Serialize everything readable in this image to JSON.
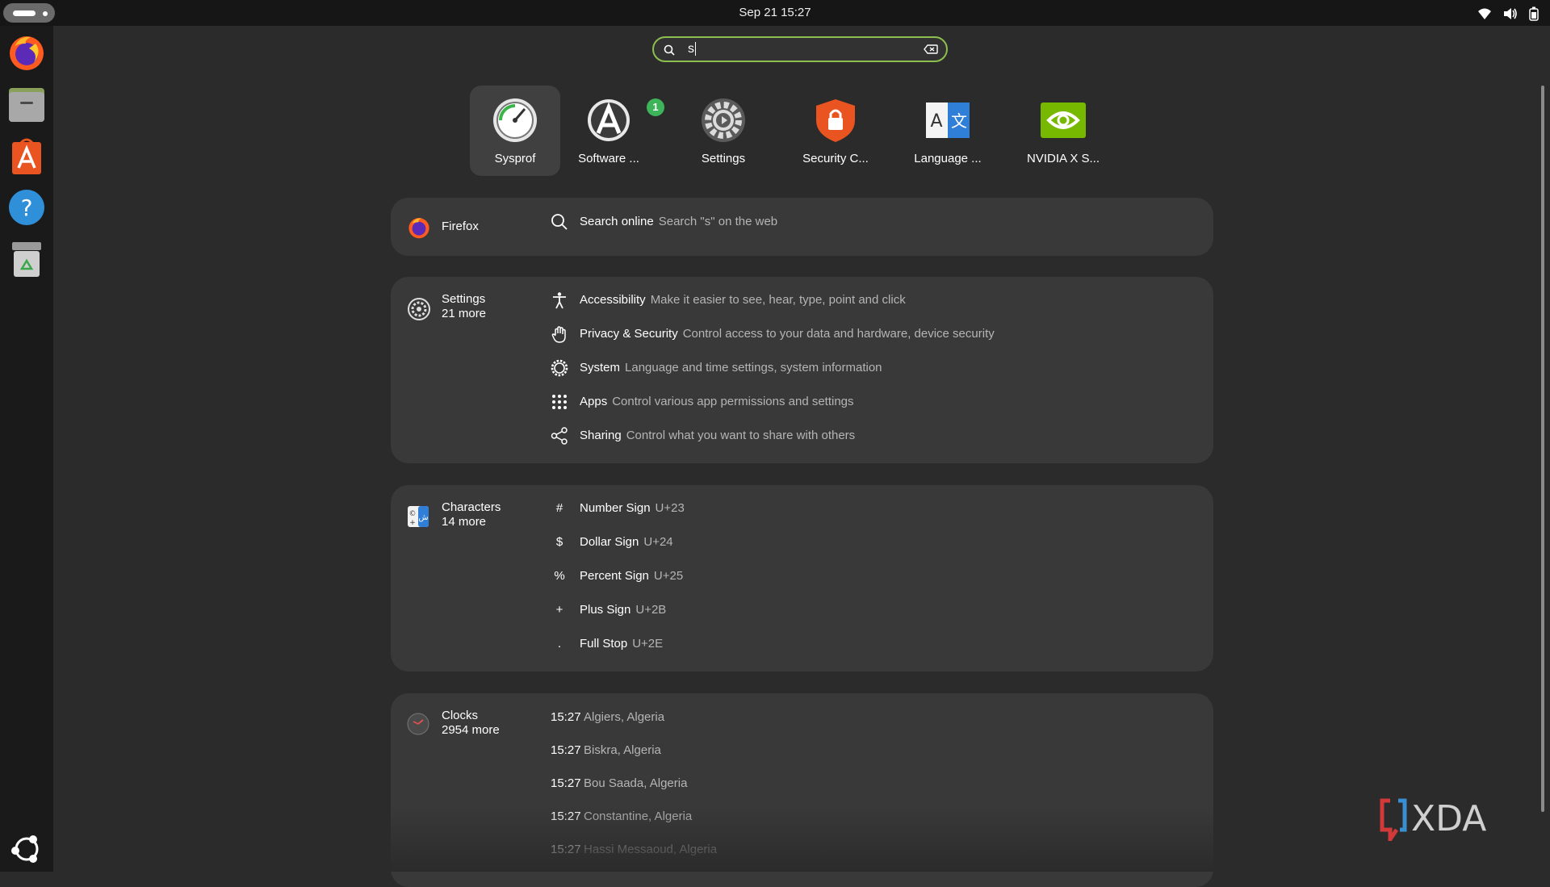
{
  "topbar": {
    "clock": "Sep 21  15:27",
    "tray_icons": [
      "wifi-icon",
      "volume-icon",
      "battery-icon"
    ]
  },
  "dock": {
    "items": [
      "firefox-icon",
      "files-icon",
      "app-center-icon",
      "help-icon",
      "trash-icon",
      "show-apps-icon"
    ]
  },
  "search": {
    "value": "s"
  },
  "apps": [
    {
      "label": "Sysprof",
      "icon": "sysprof-icon",
      "selected": true
    },
    {
      "label": "Software ...",
      "icon": "software-icon",
      "badge": "1"
    },
    {
      "label": "Settings",
      "icon": "settings-gear-icon"
    },
    {
      "label": "Security C...",
      "icon": "security-center-icon"
    },
    {
      "label": "Language ...",
      "icon": "language-icon"
    },
    {
      "label": "NVIDIA X S...",
      "icon": "nvidia-icon"
    }
  ],
  "firefox_panel": {
    "name": "Firefox",
    "result": {
      "title": "Search online",
      "desc": "Search \"s\" on the web"
    }
  },
  "settings_panel": {
    "name": "Settings",
    "more": "21 more",
    "rows": [
      {
        "icon": "accessibility-icon",
        "title": "Accessibility",
        "desc": "Make it easier to see, hear, type, point and click"
      },
      {
        "icon": "hand-icon",
        "title": "Privacy & Security",
        "desc": "Control access to your data and hardware, device security"
      },
      {
        "icon": "gear-icon",
        "title": "System",
        "desc": "Language and time settings, system information"
      },
      {
        "icon": "apps-grid-icon",
        "title": "Apps",
        "desc": "Control various app permissions and settings"
      },
      {
        "icon": "share-icon",
        "title": "Sharing",
        "desc": "Control what you want to share with others"
      }
    ]
  },
  "characters_panel": {
    "name": "Characters",
    "more": "14 more",
    "rows": [
      {
        "glyph": "#",
        "title": "Number Sign",
        "desc": "U+23"
      },
      {
        "glyph": "$",
        "title": "Dollar Sign",
        "desc": "U+24"
      },
      {
        "glyph": "%",
        "title": "Percent Sign",
        "desc": "U+25"
      },
      {
        "glyph": "+",
        "title": "Plus Sign",
        "desc": "U+2B"
      },
      {
        "glyph": ".",
        "title": "Full Stop",
        "desc": "U+2E"
      }
    ]
  },
  "clocks_panel": {
    "name": "Clocks",
    "more": "2954 more",
    "rows": [
      {
        "time": "15:27",
        "place": "Algiers, Algeria"
      },
      {
        "time": "15:27",
        "place": "Biskra, Algeria"
      },
      {
        "time": "15:27",
        "place": "Bou Saada, Algeria"
      },
      {
        "time": "15:27",
        "place": "Constantine, Algeria"
      },
      {
        "time": "15:27",
        "place": "Hassi Messaoud, Algeria"
      }
    ]
  },
  "watermark": "XDA",
  "colors": {
    "accent": "#8cbf4f",
    "panel": "#393939",
    "background": "#2b2b2b"
  }
}
